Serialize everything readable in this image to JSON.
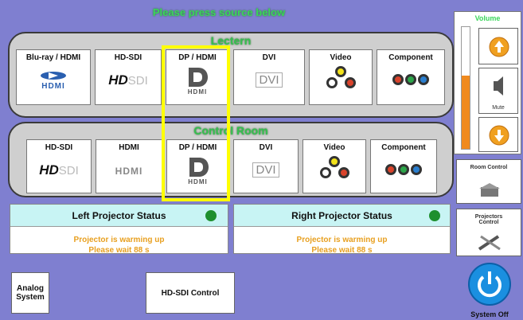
{
  "header": {
    "title": "Please press source below"
  },
  "lectern": {
    "title": "Lectern",
    "sources": [
      {
        "label": "Blu-ray / HDMI",
        "icon": "bluray-hdmi-icon"
      },
      {
        "label": "HD-SDI",
        "icon": "hdsdi-icon"
      },
      {
        "label": "DP / HDMI",
        "icon": "displayport-icon"
      },
      {
        "label": "DVI",
        "icon": "dvi-icon"
      },
      {
        "label": "Video",
        "icon": "composite-video-icon"
      },
      {
        "label": "Component",
        "icon": "component-video-icon"
      }
    ]
  },
  "control_room": {
    "title": "Control Room",
    "sources": [
      {
        "label": "HD-SDI",
        "icon": "hdsdi-icon"
      },
      {
        "label": "HDMI",
        "icon": "hdmi-icon"
      },
      {
        "label": "DP / HDMI",
        "icon": "displayport-icon"
      },
      {
        "label": "DVI",
        "icon": "dvi-icon"
      },
      {
        "label": "Video",
        "icon": "composite-video-icon"
      },
      {
        "label": "Component",
        "icon": "component-video-icon"
      }
    ]
  },
  "left_projector": {
    "title": "Left Projector Status",
    "message_line1": "Projector is warming up",
    "message_line2": "Please wait  88  s",
    "led_color": "#1e8f2e"
  },
  "right_projector": {
    "title": "Right Projector Status",
    "message_line1": "Projector is warming up",
    "message_line2": "Please wait  88  s",
    "led_color": "#1e8f2e"
  },
  "buttons": {
    "analog_system": "Analog System",
    "hdsdi_control": "HD-SDI Control"
  },
  "volume": {
    "title": "Volume",
    "mute_label": "Mute",
    "level": 0.6
  },
  "side": {
    "room_control": "Room Control",
    "projectors_control": "Projectors Control",
    "system_off": "System Off"
  },
  "colors": {
    "accent_green": "#35c04f",
    "background": "#7f7fd0",
    "highlight": "#ffff00",
    "volume_bar": "#f08a1e",
    "arrow_orange": "#f0a020",
    "power_blue": "#1a8fe0"
  },
  "text_tokens": {
    "hdmi": "HDMI",
    "dvi": "DVI",
    "hd": "HD",
    "sdi": "SDI"
  }
}
